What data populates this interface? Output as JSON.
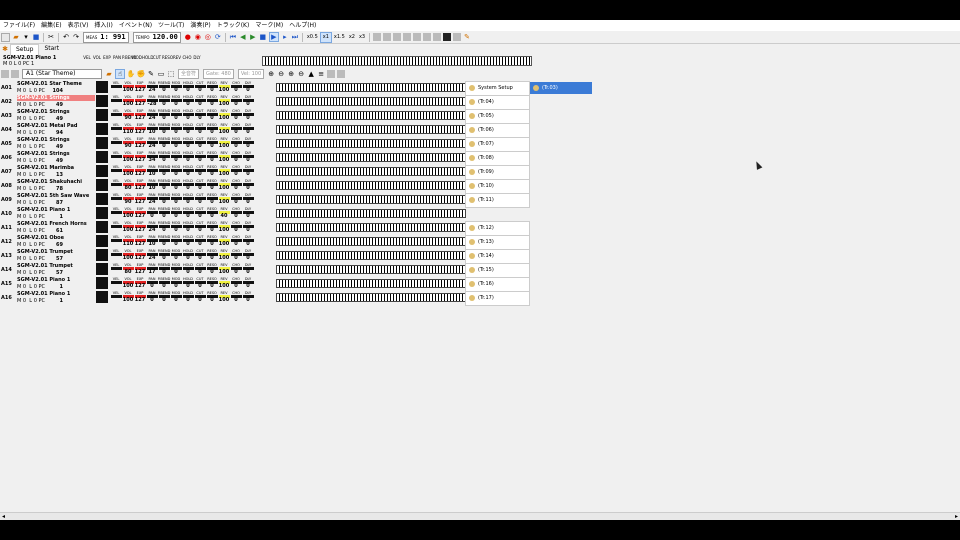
{
  "menu": [
    "ファイル(F)",
    "編集(E)",
    "表示(V)",
    "挿入(I)",
    "イベント(N)",
    "ツール(T)",
    "演奏(P)",
    "トラック(K)",
    "マーク(M)",
    "ヘルプ(H)"
  ],
  "toolbar": {
    "meas_label": "MEAS",
    "meas_value": "1: 991",
    "tempo_label": "TEMPO",
    "tempo_value": "120.00",
    "speeds": [
      "x0.5",
      "x1",
      "x1.5",
      "x2",
      "x3"
    ]
  },
  "tabs": [
    "Setup",
    "Start"
  ],
  "header": {
    "name": "SGM-V2.01 Piano 1",
    "m_label": "M",
    "m_value": "0",
    "l_label": "L",
    "l_value": "0",
    "pc_label": "PC",
    "pc_value": "1",
    "columns": [
      "VEL",
      "VOL",
      "EXP",
      "PAN",
      "P.BEND",
      "MOD",
      "HOLD",
      "CUT",
      "RESO",
      "REV",
      "CHO",
      "DLY"
    ]
  },
  "port": {
    "value": "A1 (Star Theme)",
    "fields": [
      "全音符",
      "Gate: 480",
      "Vel: 100"
    ]
  },
  "mixer_labels": [
    "VEL",
    "VOL",
    "EXP",
    "PAN",
    "P.BEND",
    "MOD",
    "HOLD",
    "CUT",
    "RESO",
    "REV",
    "CHO",
    "DLY"
  ],
  "tracks": [
    {
      "id": "A01",
      "name": "SGM-V2.01 Star Theme",
      "m": "0",
      "l": "0",
      "pc": "104",
      "vol": "100",
      "exp": "127",
      "pan": "24",
      "rev": "100",
      "tn": "System Setup"
    },
    {
      "id": "A02",
      "name": "SGM-V2.01 Strings",
      "m": "0",
      "l": "0",
      "pc": "49",
      "vol": "100",
      "exp": "127",
      "pan": "-28",
      "rev": "100",
      "tn": "(Tr.04)"
    },
    {
      "id": "A03",
      "name": "SGM-V2.01 Strings",
      "m": "0",
      "l": "0",
      "pc": "49",
      "vol": "90",
      "exp": "127",
      "pan": "24",
      "rev": "100",
      "tn": "(Tr.05)"
    },
    {
      "id": "A04",
      "name": "SGM-V2.01 Metal Pad",
      "m": "0",
      "l": "0",
      "pc": "94",
      "vol": "110",
      "exp": "127",
      "pan": "10",
      "rev": "100",
      "tn": "(Tr.06)"
    },
    {
      "id": "A05",
      "name": "SGM-V2.01 Strings",
      "m": "0",
      "l": "0",
      "pc": "49",
      "vol": "90",
      "exp": "127",
      "pan": "24",
      "rev": "100",
      "tn": "(Tr.07)"
    },
    {
      "id": "A06",
      "name": "SGM-V2.01 Strings",
      "m": "0",
      "l": "0",
      "pc": "49",
      "vol": "100",
      "exp": "127",
      "pan": "34",
      "rev": "100",
      "tn": "(Tr.08)"
    },
    {
      "id": "A07",
      "name": "SGM-V2.01 Marimba",
      "m": "0",
      "l": "0",
      "pc": "13",
      "vol": "100",
      "exp": "127",
      "pan": "10",
      "rev": "100",
      "tn": "(Tr.09)"
    },
    {
      "id": "A08",
      "name": "SGM-V2.01 Shakuhachi",
      "m": "0",
      "l": "0",
      "pc": "78",
      "vol": "80",
      "exp": "127",
      "pan": "10",
      "rev": "100",
      "tn": "(Tr.10)"
    },
    {
      "id": "A09",
      "name": "SGM-V2.01 5th Saw Wave",
      "m": "0",
      "l": "0",
      "pc": "87",
      "vol": "90",
      "exp": "127",
      "pan": "24",
      "rev": "100",
      "tn": "(Tr.11)"
    },
    {
      "id": "A10",
      "name": "SGM-V2.01 Piano 1",
      "m": "0",
      "l": "0",
      "pc": "1",
      "vol": "100",
      "exp": "127",
      "pan": "0",
      "rev": "40",
      "tn": ""
    },
    {
      "id": "A11",
      "name": "SGM-V2.01 French Horns",
      "m": "0",
      "l": "0",
      "pc": "61",
      "vol": "100",
      "exp": "127",
      "pan": "24",
      "rev": "100",
      "tn": "(Tr.12)"
    },
    {
      "id": "A12",
      "name": "SGM-V2.01 Oboe",
      "m": "0",
      "l": "0",
      "pc": "69",
      "vol": "110",
      "exp": "127",
      "pan": "10",
      "rev": "100",
      "tn": "(Tr.13)"
    },
    {
      "id": "A13",
      "name": "SGM-V2.01 Trumpet",
      "m": "0",
      "l": "0",
      "pc": "57",
      "vol": "100",
      "exp": "127",
      "pan": "24",
      "rev": "100",
      "tn": "(Tr.14)"
    },
    {
      "id": "A14",
      "name": "SGM-V2.01 Trumpet",
      "m": "0",
      "l": "0",
      "pc": "57",
      "vol": "80",
      "exp": "127",
      "pan": "17",
      "rev": "100",
      "tn": "(Tr.15)"
    },
    {
      "id": "A15",
      "name": "SGM-V2.01 Piano 1",
      "m": "0",
      "l": "0",
      "pc": "1",
      "vol": "100",
      "exp": "127",
      "pan": "0",
      "rev": "100",
      "tn": "(Tr.16)"
    },
    {
      "id": "A16",
      "name": "SGM-V2.01 Piano 1",
      "m": "0",
      "l": "0",
      "pc": "1",
      "vol": "100",
      "exp": "127",
      "pan": "0",
      "rev": "100",
      "tn": "(Tr.17)"
    }
  ],
  "selected_track": "(Tr.03)",
  "colors": {
    "highlight": "#f08080",
    "selected": "#3b7bd6",
    "meter_red": "#e02020",
    "meter_yellow": "#f0f040"
  }
}
